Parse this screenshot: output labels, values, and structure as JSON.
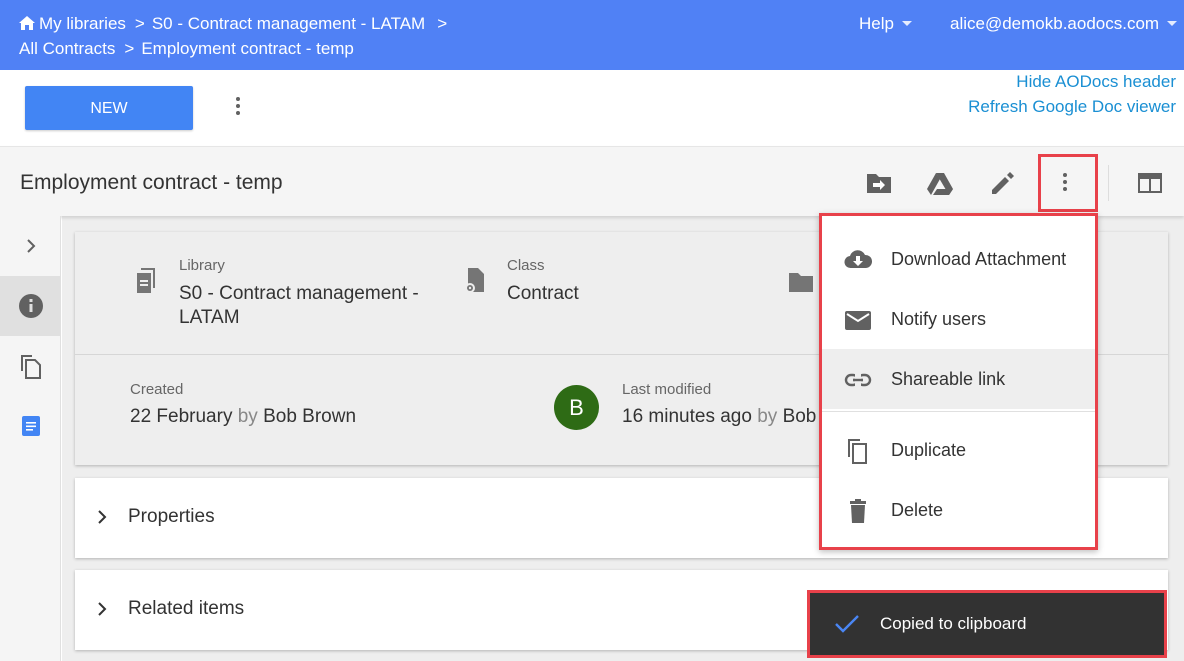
{
  "header": {
    "breadcrumbs_row1": [
      "My libraries",
      "S0 - Contract management - LATAM"
    ],
    "breadcrumbs_row2": [
      "All Contracts",
      "Employment contract - temp"
    ],
    "breadcrumb_separator": ">",
    "help_label": "Help",
    "user_email": "alice@demokb.aodocs.com",
    "brand_color": "#5081f5"
  },
  "actions": {
    "new_label": "NEW",
    "hide_header_link": "Hide AODocs header",
    "refresh_viewer_link": "Refresh Google Doc viewer"
  },
  "document": {
    "title": "Employment contract - temp",
    "toolbar_icons": [
      "move-to-folder-icon",
      "google-drive-icon",
      "edit-pencil-icon",
      "more-vert-icon",
      "layout-icon"
    ]
  },
  "rail": {
    "icons": [
      "chevron-right-icon",
      "info-icon",
      "versions-copy-icon",
      "google-doc-icon"
    ]
  },
  "info": {
    "library_label": "Library",
    "library_value_line1": "S0 - Contract management -",
    "library_value_line2": "LATAM",
    "class_label": "Class",
    "class_value": "Contract",
    "created_label": "Created",
    "created_date": "22 February",
    "created_by_word": "by",
    "created_by": "Bob Brown",
    "avatar_initial": "B",
    "modified_label": "Last modified",
    "modified_time": "16 minutes ago",
    "modified_by_word": "by",
    "modified_by_partial": "Bob"
  },
  "sections": {
    "properties": "Properties",
    "related_items": "Related items"
  },
  "menu": {
    "items": [
      {
        "label": "Download Attachment",
        "icon": "cloud-download-icon"
      },
      {
        "label": "Notify users",
        "icon": "mail-icon"
      },
      {
        "label": "Shareable link",
        "icon": "link-icon",
        "highlighted": true
      },
      {
        "label": "Duplicate",
        "icon": "duplicate-icon"
      },
      {
        "label": "Delete",
        "icon": "trash-icon"
      }
    ]
  },
  "snackbar": {
    "message": "Copied to clipboard",
    "icon": "check-icon"
  },
  "colors": {
    "accent_blue": "#4285f4",
    "link_blue": "#1a8fd3",
    "highlight_red": "#e8414a",
    "avatar_green": "#2e6b15"
  }
}
